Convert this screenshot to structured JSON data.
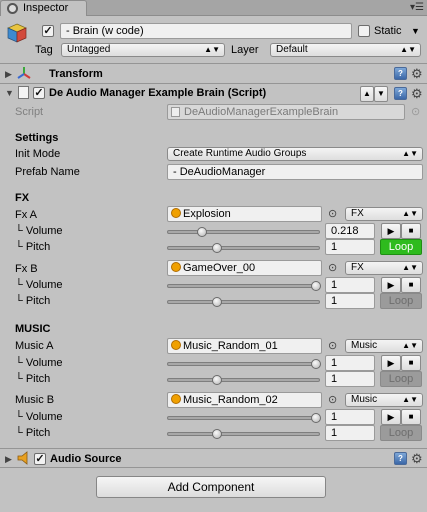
{
  "tab": {
    "title": "Inspector"
  },
  "gameobject": {
    "name": "- Brain (w code)",
    "static_label": "Static",
    "tag_label": "Tag",
    "tag_value": "Untagged",
    "layer_label": "Layer",
    "layer_value": "Default"
  },
  "transform": {
    "title": "Transform"
  },
  "script_component": {
    "title": "De Audio Manager Example Brain (Script)",
    "script_label": "Script",
    "script_value": "DeAudioManagerExampleBrain"
  },
  "settings": {
    "header": "Settings",
    "init_mode_label": "Init Mode",
    "init_mode_value": "Create Runtime Audio Groups",
    "prefab_name_label": "Prefab Name",
    "prefab_name_value": "- DeAudioManager"
  },
  "fx": {
    "header": "FX",
    "items": [
      {
        "label": "Fx A",
        "clip": "Explosion",
        "group": "FX",
        "volume_label": "└ Volume",
        "volume": "0.218",
        "volume_level": 0.218,
        "pitch_label": "└ Pitch",
        "pitch": "1",
        "pitch_level": 0.333,
        "loop": "Loop",
        "loop_on": true
      },
      {
        "label": "Fx B",
        "clip": "GameOver_00",
        "group": "FX",
        "volume_label": "└ Volume",
        "volume": "1",
        "volume_level": 1.0,
        "pitch_label": "└ Pitch",
        "pitch": "1",
        "pitch_level": 0.333,
        "loop": "Loop",
        "loop_on": false
      }
    ]
  },
  "music": {
    "header": "MUSIC",
    "items": [
      {
        "label": "Music A",
        "clip": "Music_Random_01",
        "group": "Music",
        "volume_label": "└ Volume",
        "volume": "1",
        "volume_level": 1.0,
        "pitch_label": "└ Pitch",
        "pitch": "1",
        "pitch_level": 0.333,
        "loop": "Loop",
        "loop_on": false
      },
      {
        "label": "Music B",
        "clip": "Music_Random_02",
        "group": "Music",
        "volume_label": "└ Volume",
        "volume": "1",
        "volume_level": 1.0,
        "pitch_label": "└ Pitch",
        "pitch": "1",
        "pitch_level": 0.333,
        "loop": "Loop",
        "loop_on": false
      }
    ]
  },
  "audio_source": {
    "title": "Audio Source"
  },
  "add_component": {
    "label": "Add Component"
  },
  "colors": {
    "loop_on": "#2ebb1e",
    "panel_bg": "#c2c2c2"
  }
}
